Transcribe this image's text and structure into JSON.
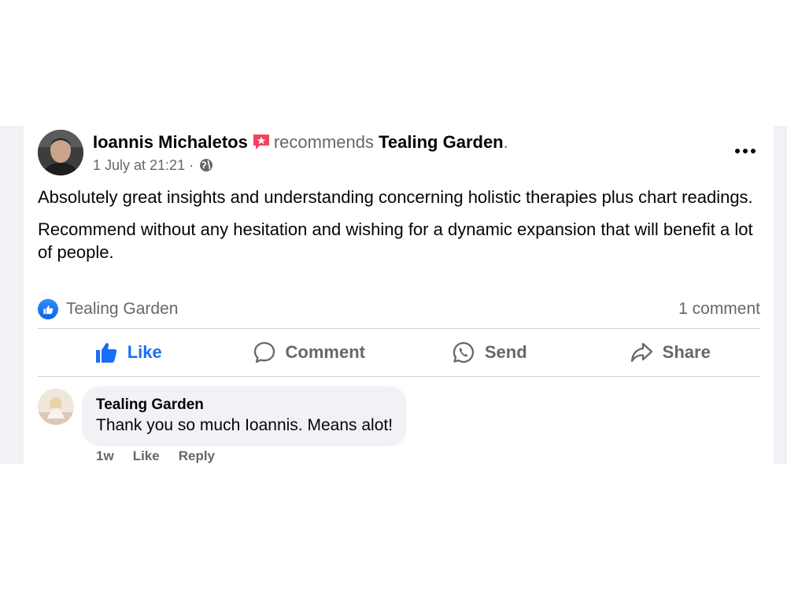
{
  "post": {
    "author": "Ioannis Michaletos",
    "recommends": "recommends",
    "page": "Tealing Garden",
    "period": ".",
    "date": "1 July at 21:21",
    "separator": "·",
    "paragraphs": [
      "Absolutely great insights and understanding concerning holistic therapies plus chart readings.",
      "Recommend without any hesitation and wishing for a dynamic expansion that will benefit a lot of people."
    ],
    "reaction_by": "Tealing Garden",
    "comment_count": "1 comment"
  },
  "actions": {
    "like": "Like",
    "comment": "Comment",
    "send": "Send",
    "share": "Share"
  },
  "comment": {
    "author": "Tealing Garden",
    "text": "Thank you so much Ioannis. Means alot!",
    "time": "1w",
    "like": "Like",
    "reply": "Reply"
  },
  "colors": {
    "accent": "#1a6ef5",
    "muted_text": "#65676b",
    "recommend_badge": "#f3425f"
  }
}
